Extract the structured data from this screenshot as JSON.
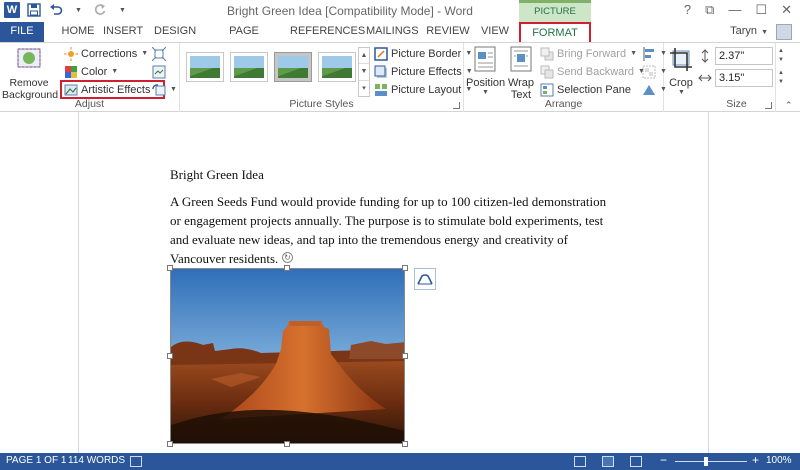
{
  "window": {
    "title": "Bright Green Idea [Compatibility Mode] - Word",
    "context_tab_group": "PICTURE TOOLS",
    "controls": {
      "help": "?",
      "ribbon_display": "⧉",
      "minimize": "—",
      "restore": "☐",
      "close": "✕"
    }
  },
  "quick_access": {
    "app_logo": "W",
    "save_icon": "save-icon",
    "undo_icon": "undo-icon",
    "redo_icon": "redo-icon"
  },
  "tabs": [
    {
      "label": "FILE"
    },
    {
      "label": "HOME"
    },
    {
      "label": "INSERT"
    },
    {
      "label": "DESIGN"
    },
    {
      "label": "PAGE LAYOUT"
    },
    {
      "label": "REFERENCES"
    },
    {
      "label": "MAILINGS"
    },
    {
      "label": "REVIEW"
    },
    {
      "label": "VIEW"
    },
    {
      "label": "FORMAT"
    }
  ],
  "user": {
    "name": "Taryn"
  },
  "ribbon": {
    "adjust": {
      "label": "Adjust",
      "remove_background": "Remove Background",
      "corrections": "Corrections",
      "color": "Color",
      "artistic_effects": "Artistic Effects"
    },
    "picture_styles": {
      "label": "Picture Styles",
      "picture_border": "Picture Border",
      "picture_effects": "Picture Effects",
      "picture_layout": "Picture Layout"
    },
    "arrange": {
      "label": "Arrange",
      "position": "Position",
      "wrap_text": "Wrap Text",
      "bring_forward": "Bring Forward",
      "send_backward": "Send Backward",
      "selection_pane": "Selection Pane"
    },
    "crop": {
      "label": "Crop"
    },
    "size": {
      "label": "Size",
      "height": "2.37\"",
      "width": "3.15\""
    }
  },
  "document": {
    "heading": "Bright Green Idea",
    "paragraph": "A Green Seeds Fund would provide funding for up to 100 citizen-led demonstration or engagement projects annually. The purpose is to stimulate bold experiments, test and evaluate new ideas, and tap into the tremendous energy and creativity of Vancouver residents."
  },
  "status": {
    "page": "PAGE 1 OF 1",
    "words": "114 WORDS",
    "zoom": "100%",
    "zoom_minus": "−",
    "zoom_plus": "+"
  },
  "colors": {
    "word_blue": "#2b579a",
    "format_green": "#217346",
    "highlight_red": "#d02030",
    "context_tab_bg": "#cde6c7"
  }
}
